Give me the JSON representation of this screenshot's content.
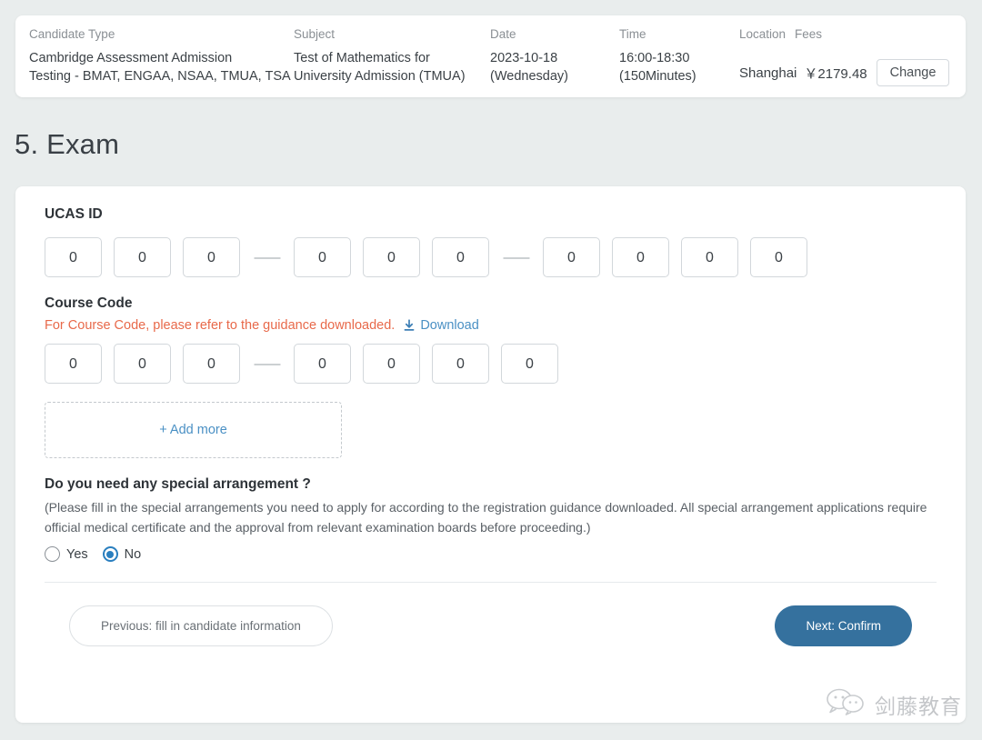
{
  "summary": {
    "columns": [
      {
        "label": "Candidate Type",
        "value": "Cambridge Assessment Admission Testing - BMAT, ENGAA, NSAA, TMUA, TSA"
      },
      {
        "label": "Subject",
        "value": "Test of Mathematics for University Admission (TMUA)"
      },
      {
        "label": "Date",
        "value": "2023-10-18 (Wednesday)"
      },
      {
        "label": "Time",
        "value": "16:00-18:30 (150Minutes)"
      }
    ],
    "candidate_type_line1": "Cambridge Assessment Admission",
    "candidate_type_line2": "Testing - BMAT, ENGAA, NSAA, TMUA, TSA",
    "subject_line1": "Test of Mathematics for",
    "subject_line2": "University Admission (TMUA)",
    "date_line1": "2023-10-18",
    "date_line2": "(Wednesday)",
    "time_line1": "16:00-18:30",
    "time_line2": "(150Minutes)",
    "location_label": "Location",
    "fees_label": "Fees",
    "location_value": "Shanghai",
    "fees_value": "￥2179.48",
    "change_label": "Change"
  },
  "page": {
    "title": "5. Exam"
  },
  "ucas": {
    "label": "UCAS ID",
    "groups": [
      {
        "digits": [
          "0",
          "0",
          "0"
        ]
      },
      {
        "digits": [
          "0",
          "0",
          "0"
        ]
      },
      {
        "digits": [
          "0",
          "0",
          "0",
          "0"
        ]
      }
    ],
    "separator": "——"
  },
  "course_code": {
    "label": "Course Code",
    "hint": "For Course Code, please refer to the guidance downloaded.",
    "download_label": "Download",
    "download_icon": "download-icon",
    "groups": [
      {
        "digits": [
          "0",
          "0",
          "0"
        ]
      },
      {
        "digits": [
          "0",
          "0",
          "0",
          "0"
        ]
      }
    ],
    "separator": "——",
    "add_more_label": "+ Add more"
  },
  "special_arrangement": {
    "question": "Do you need any special arrangement ?",
    "note": "(Please fill in the special arrangements you need to apply for according to the registration guidance downloaded. All special arrangement applications require official medical certificate and the approval from relevant examination boards before proceeding.)",
    "options": [
      {
        "label": "Yes",
        "selected": false
      },
      {
        "label": "No",
        "selected": true
      }
    ]
  },
  "actions": {
    "previous_label": "Previous: fill in candidate information",
    "next_label": "Next: Confirm"
  },
  "watermark": {
    "icon": "wechat-icon",
    "text": "剑藤教育"
  },
  "colors": {
    "background": "#e9eded",
    "card": "#ffffff",
    "accent_blue": "#35719e",
    "link_blue": "#4a90c4",
    "hint_orange": "#e8694a",
    "radio_selected": "#2a7fbf"
  }
}
